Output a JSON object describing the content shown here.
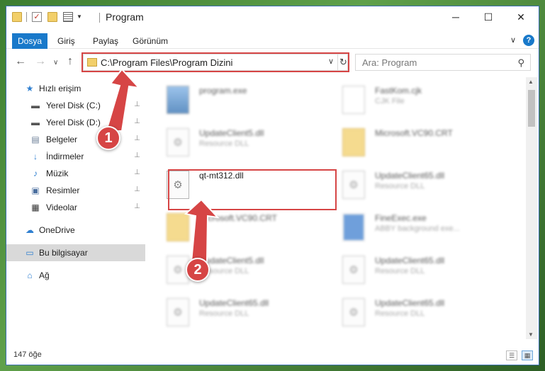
{
  "window": {
    "title": "Program",
    "controls": {
      "minimize": "─",
      "maximize": "☐",
      "close": "✕"
    }
  },
  "ribbon": {
    "file_tab": "Dosya",
    "tabs": [
      "Giriş",
      "Paylaş",
      "Görünüm"
    ],
    "expand_glyph": "∨",
    "help_glyph": "?"
  },
  "nav": {
    "back": "←",
    "forward": "→",
    "recent": "∨",
    "up": "↑",
    "address": "C:\\Program Files\\Program Dizini",
    "address_dropdown": "∨",
    "refresh": "↻",
    "search_placeholder": "Ara: Program",
    "search_glyph": "⚲"
  },
  "sidebar": {
    "items": [
      {
        "label": "Hızlı erişim",
        "icon": "star-icon",
        "glyph": "★",
        "pinned": false
      },
      {
        "label": "Yerel Disk (C:)",
        "icon": "drive-icon",
        "glyph": "▬",
        "pinned": true
      },
      {
        "label": "Yerel Disk (D:)",
        "icon": "drive-icon",
        "glyph": "▬",
        "pinned": true
      },
      {
        "label": "Belgeler",
        "icon": "documents-icon",
        "glyph": "▤",
        "pinned": true
      },
      {
        "label": "İndirmeler",
        "icon": "download-icon",
        "glyph": "↓",
        "pinned": true
      },
      {
        "label": "Müzik",
        "icon": "music-icon",
        "glyph": "♪",
        "pinned": true
      },
      {
        "label": "Resimler",
        "icon": "pictures-icon",
        "glyph": "▣",
        "pinned": true
      },
      {
        "label": "Videolar",
        "icon": "video-icon",
        "glyph": "▦",
        "pinned": true
      },
      {
        "label": "OneDrive",
        "icon": "cloud-icon",
        "glyph": "☁",
        "pinned": false
      },
      {
        "label": "Bu bilgisayar",
        "icon": "computer-icon",
        "glyph": "▭",
        "pinned": false,
        "selected": true
      },
      {
        "label": "Ağ",
        "icon": "network-icon",
        "glyph": "⌂",
        "pinned": false
      }
    ],
    "pin_glyph": "📌"
  },
  "files": [
    {
      "name": "program.exe",
      "sub": "",
      "kind": "setup",
      "blurred": true
    },
    {
      "name": "FastKom.cjk",
      "sub": "CJK File",
      "kind": "doc",
      "blurred": true
    },
    {
      "name": "UpdateClient5.dll",
      "sub": "Resource DLL",
      "kind": "dll",
      "blurred": true
    },
    {
      "name": "Microsoft.VC90.CRT",
      "sub": "",
      "kind": "folder",
      "blurred": true
    },
    {
      "name": "qt-mt312.dll",
      "sub": "",
      "kind": "dll",
      "blurred": false
    },
    {
      "name": "UpdateClient65.dll",
      "sub": "Resource DLL",
      "kind": "dll",
      "blurred": true
    },
    {
      "name": "Microsoft.VC90.CRT",
      "sub": "",
      "kind": "folder",
      "blurred": true
    },
    {
      "name": "FineExec.exe",
      "sub": "ABBY background exe...",
      "kind": "exe",
      "blurred": true
    },
    {
      "name": "UpdateClient5.dll",
      "sub": "Resource DLL",
      "kind": "dll",
      "blurred": true
    },
    {
      "name": "UpdateClient65.dll",
      "sub": "Resource DLL",
      "kind": "dll",
      "blurred": true
    },
    {
      "name": "UpdateClient65.dll",
      "sub": "Resource DLL",
      "kind": "dll",
      "blurred": true
    },
    {
      "name": "UpdateClient65.dll",
      "sub": "Resource DLL",
      "kind": "dll",
      "blurred": true
    }
  ],
  "status": {
    "count": "147 öğe",
    "details_view_glyph": "☰",
    "tiles_view_glyph": "▦"
  },
  "annotations": {
    "step1": "1",
    "step2": "2",
    "color": "#d64545"
  },
  "colors": {
    "accent": "#1979ca",
    "highlight": "#d64545",
    "selected": "#d9d9d9"
  }
}
